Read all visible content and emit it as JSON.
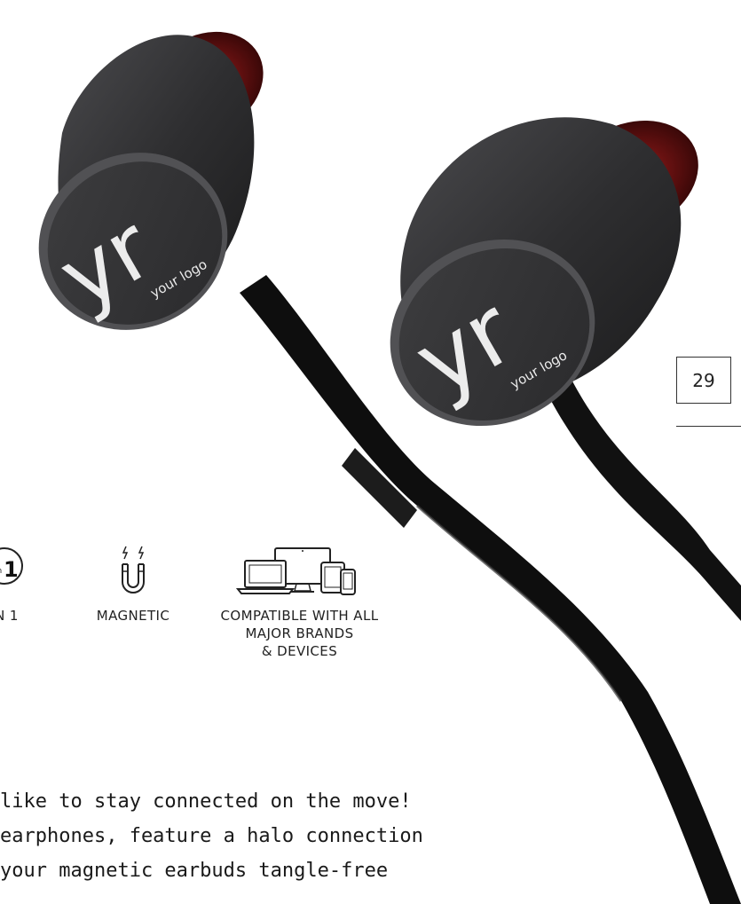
{
  "page": {
    "number": "29"
  },
  "product": {
    "logo_mark": "yr",
    "logo_caption": "your logo"
  },
  "features": [
    {
      "icon": "two-in-one-icon",
      "badge_small": "in",
      "badge_big": "1",
      "label": "N 1"
    },
    {
      "icon": "magnet-icon",
      "label": "MAGNETIC"
    },
    {
      "icon": "devices-icon",
      "label": "COMPATIBLE WITH ALL\nMAJOR BRANDS\n& DEVICES"
    }
  ],
  "description": {
    "lines": [
      " like to stay connected on the move!",
      "earphones, feature a halo connection",
      "your magnetic earbuds tangle-free"
    ]
  },
  "colors": {
    "earbud_body": "#2f2f31",
    "earbud_accent": "#7a1414",
    "cable": "#0d0d0d"
  }
}
